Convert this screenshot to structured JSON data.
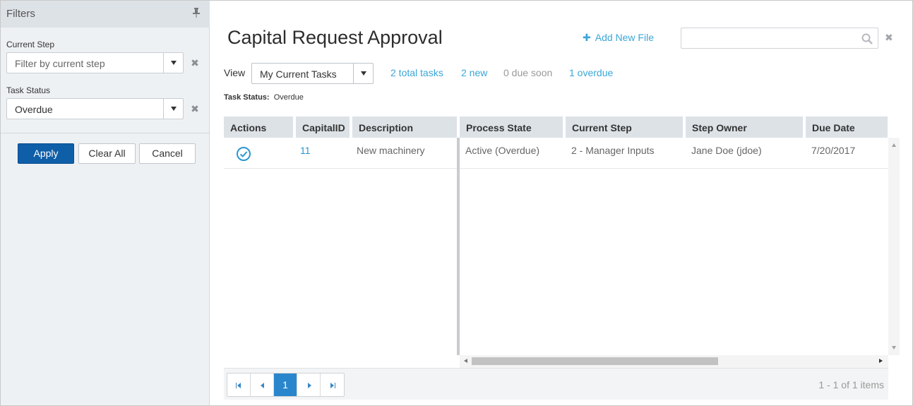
{
  "filters": {
    "title": "Filters",
    "current_step": {
      "label": "Current Step",
      "placeholder": "Filter by current step"
    },
    "task_status": {
      "label": "Task Status",
      "value": "Overdue"
    },
    "buttons": {
      "apply": "Apply",
      "clear_all": "Clear All",
      "cancel": "Cancel"
    }
  },
  "header": {
    "title": "Capital Request Approval",
    "add_new_file": "Add New File",
    "search": {
      "value": ""
    }
  },
  "view": {
    "label": "View",
    "selected": "My Current Tasks",
    "stats": {
      "total": "2 total tasks",
      "new": "2 new",
      "due_soon": "0 due soon",
      "overdue": "1 overdue"
    }
  },
  "active_filter": {
    "label": "Task Status:",
    "value": "Overdue"
  },
  "grid": {
    "columns": [
      "Actions",
      "CapitalID",
      "Description",
      "Process State",
      "Current Step",
      "Step Owner",
      "Due Date"
    ],
    "rows": [
      {
        "capital_id": "11",
        "description": "New machinery",
        "process_state": "Active (Overdue)",
        "current_step": "2 - Manager Inputs",
        "step_owner": "Jane Doe (jdoe)",
        "due_date": "7/20/2017"
      }
    ]
  },
  "pager": {
    "current_page": "1",
    "info": "1 - 1 of 1 items"
  },
  "colors": {
    "accent": "#3ba6d8",
    "primary_button": "#0f5ea8",
    "page_active": "#2a86cc",
    "header_bg": "#dde2e7"
  },
  "icons": [
    "pin-icon",
    "chevron-down-icon",
    "close-icon",
    "plus-icon",
    "search-icon",
    "check-circle-icon"
  ]
}
